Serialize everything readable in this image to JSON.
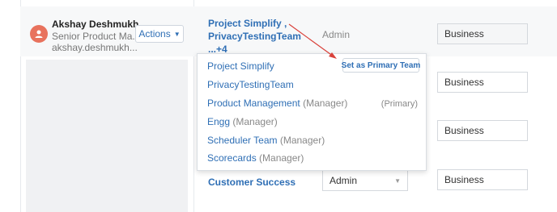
{
  "user": {
    "name": "Akshay Deshmukh",
    "title": "Senior Product Ma...",
    "email": "akshay.deshmukh..."
  },
  "actions": {
    "label": "Actions"
  },
  "teams_cell": {
    "line1": "Project Simplify ,",
    "line2": "PrivacyTestingTeam",
    "line3": "...+4"
  },
  "role": {
    "value": "Admin"
  },
  "business": [
    "Business",
    "Business",
    "Business",
    "Business"
  ],
  "dropdown": {
    "items": [
      {
        "name": "Project Simplify",
        "suffix": ""
      },
      {
        "name": "PrivacyTestingTeam",
        "suffix": ""
      },
      {
        "name": "Product Management",
        "suffix": "(Manager)"
      },
      {
        "name": "Engg",
        "suffix": "(Manager)"
      },
      {
        "name": "Scheduler Team",
        "suffix": "(Manager)"
      },
      {
        "name": "Scorecards",
        "suffix": "(Manager)"
      }
    ],
    "primary_tag": "(Primary)",
    "set_primary_label": "Set as Primary Team"
  },
  "last_row": {
    "team": "Customer Success",
    "role": "Admin"
  },
  "colors": {
    "link": "#2f6fb5",
    "avatar": "#e8725d",
    "arrow": "#d9413a"
  }
}
